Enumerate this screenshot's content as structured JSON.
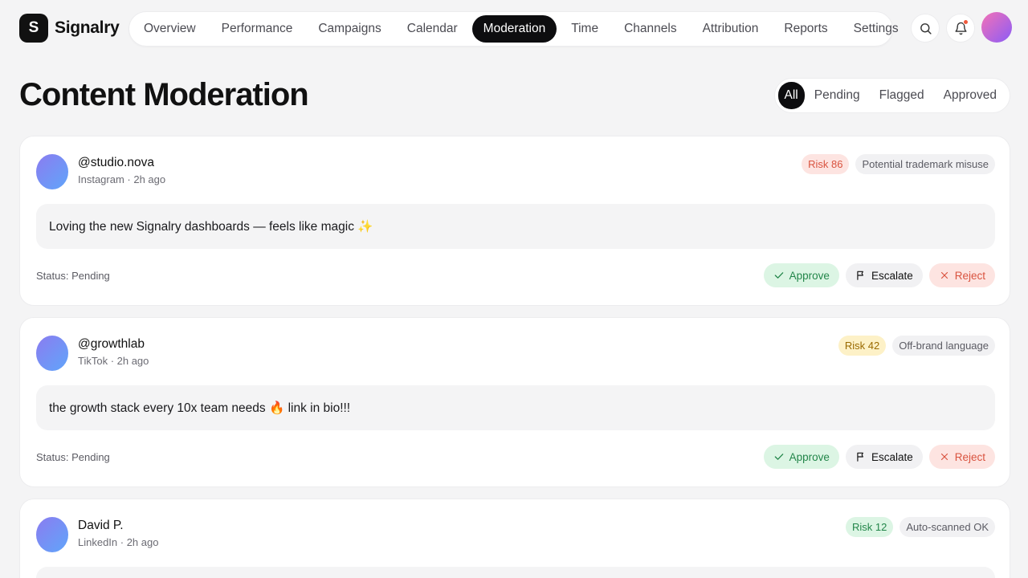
{
  "brand": {
    "logo_letter": "S",
    "name": "Signalry"
  },
  "nav": {
    "items": [
      {
        "label": "Overview"
      },
      {
        "label": "Performance"
      },
      {
        "label": "Campaigns"
      },
      {
        "label": "Calendar"
      },
      {
        "label": "Moderation",
        "active": true
      },
      {
        "label": "Time"
      },
      {
        "label": "Channels"
      },
      {
        "label": "Attribution"
      },
      {
        "label": "Reports"
      },
      {
        "label": "Settings"
      }
    ]
  },
  "header_icons": [
    "search-icon",
    "bell-icon"
  ],
  "page": {
    "title": "Content Moderation"
  },
  "filters": [
    {
      "label": "All",
      "active": true
    },
    {
      "label": "Pending"
    },
    {
      "label": "Flagged"
    },
    {
      "label": "Approved"
    }
  ],
  "posts": [
    {
      "handle": "@studio.nova",
      "meta": "Instagram · 2h ago",
      "risk": "Risk 86",
      "risk_level": "high",
      "note": "Potential trademark misuse",
      "content": "Loving the new Signalry dashboards — feels like magic ✨",
      "status": "Status: Pending"
    },
    {
      "handle": "@growthlab",
      "meta": "TikTok · 2h ago",
      "risk": "Risk 42",
      "risk_level": "mid",
      "note": "Off-brand language",
      "content": "the growth stack every 10x team needs 🔥 link in bio!!!",
      "status": "Status: Pending"
    },
    {
      "handle": "David P.",
      "meta": "LinkedIn · 2h ago",
      "risk": "Risk 12",
      "risk_level": "low",
      "note": "Auto-scanned OK",
      "content": "",
      "status": ""
    }
  ],
  "actions": {
    "approve": "Approve",
    "escalate": "Escalate",
    "reject": "Reject"
  },
  "colors": {
    "accent": "#0d0d0f",
    "risk_high": "#d9533f",
    "risk_mid": "#9a6a00",
    "risk_low": "#23864a",
    "notification": "#ef5a3c"
  }
}
